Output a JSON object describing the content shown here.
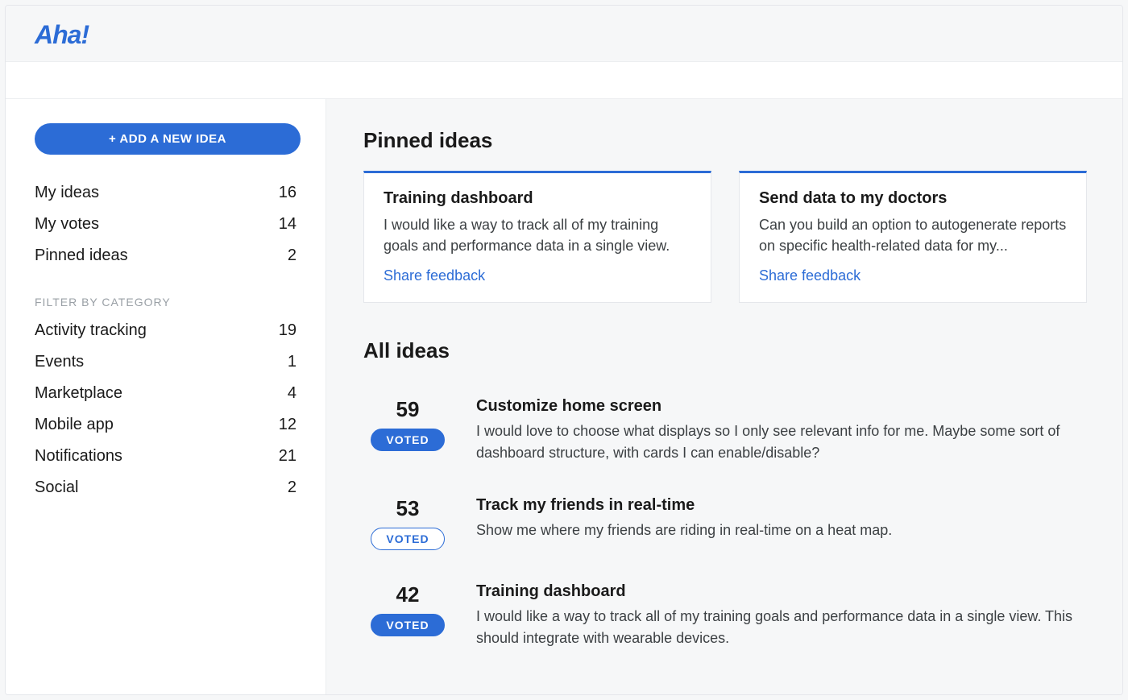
{
  "brand": {
    "logo_text": "Aha!"
  },
  "sidebar": {
    "add_button_label": "+ ADD A NEW IDEA",
    "nav": [
      {
        "id": "my-ideas",
        "label": "My ideas",
        "count": "16"
      },
      {
        "id": "my-votes",
        "label": "My votes",
        "count": "14"
      },
      {
        "id": "pinned-ideas",
        "label": "Pinned ideas",
        "count": "2"
      }
    ],
    "filter_heading": "FILTER BY CATEGORY",
    "categories": [
      {
        "id": "activity-tracking",
        "label": "Activity tracking",
        "count": "19"
      },
      {
        "id": "events",
        "label": "Events",
        "count": "1"
      },
      {
        "id": "marketplace",
        "label": "Marketplace",
        "count": "4"
      },
      {
        "id": "mobile-app",
        "label": "Mobile app",
        "count": "12"
      },
      {
        "id": "notifications",
        "label": "Notifications",
        "count": "21"
      },
      {
        "id": "social",
        "label": "Social",
        "count": "2"
      }
    ]
  },
  "main": {
    "pinned_title": "Pinned ideas",
    "pinned": [
      {
        "id": "training-dashboard",
        "title": "Training dashboard",
        "desc": "I would like a way to track all of my training goals and performance data in a single view.",
        "share_label": "Share feedback"
      },
      {
        "id": "send-data-doctors",
        "title": "Send data to my doctors",
        "desc": "Can you build an option to autogenerate reports on specific health-related data for my...",
        "share_label": "Share feedback"
      }
    ],
    "all_title": "All ideas",
    "voted_label": "VOTED",
    "ideas": [
      {
        "id": "customize-home",
        "votes": "59",
        "voted_style": "filled",
        "title": "Customize home screen",
        "desc": "I would love to choose what displays so I only see relevant info for me. Maybe some sort of dashboard structure, with cards I can enable/disable?"
      },
      {
        "id": "track-friends",
        "votes": "53",
        "voted_style": "outline",
        "title": "Track my friends in real-time",
        "desc": "Show me where my friends are riding in real-time on a heat map."
      },
      {
        "id": "training-dashboard-2",
        "votes": "42",
        "voted_style": "filled",
        "title": "Training dashboard",
        "desc": "I would like a way to track all of my training goals and performance data in a single view. This should integrate with wearable devices."
      }
    ]
  }
}
